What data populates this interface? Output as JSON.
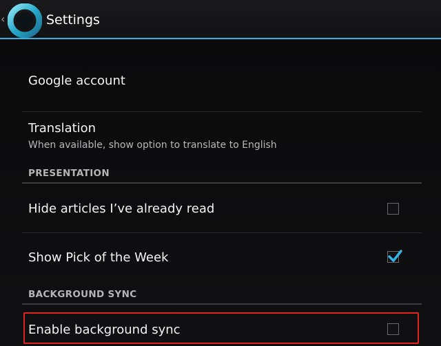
{
  "actionbar": {
    "title": "Settings",
    "back_icon": "back-chevron-icon",
    "app_icon": "app-ring-logo-icon"
  },
  "settings": {
    "google_account": {
      "title": "Google account"
    },
    "translation": {
      "title": "Translation",
      "summary": "When available, show option to translate to English"
    },
    "presentation_header": "PRESENTATION",
    "hide_read": {
      "title": "Hide articles I’ve already read",
      "checked": false
    },
    "pick_of_week": {
      "title": "Show Pick of the Week",
      "checked": true
    },
    "background_sync_header": "BACKGROUND SYNC",
    "enable_sync": {
      "title": "Enable background sync",
      "checked": false
    }
  },
  "colors": {
    "accent": "#33b5e5",
    "highlight": "#e0261f",
    "background": "#0b0b0c"
  }
}
